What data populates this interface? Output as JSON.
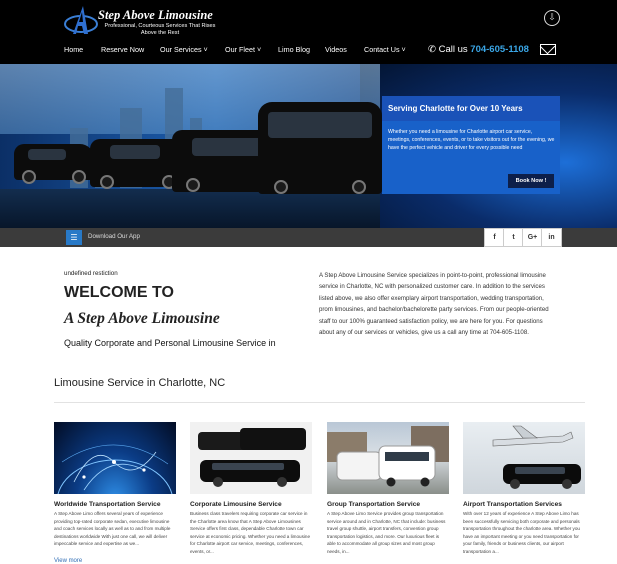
{
  "header": {
    "logo_name": "Step Above Limousine",
    "logo_tagline": "Professional, Courteous Services That Rises Above the Rest",
    "phone_label": "Call us",
    "phone_number": "704-605-1108"
  },
  "nav": {
    "items": [
      {
        "label": "Home"
      },
      {
        "label": "Reserve Now"
      },
      {
        "label": "Our Services ˅"
      },
      {
        "label": "Our Fleet ˅"
      },
      {
        "label": "Limo Blog"
      },
      {
        "label": "Videos"
      },
      {
        "label": "Contact Us ˅"
      }
    ]
  },
  "hero": {
    "promo_title": "Serving Charlotte for Over 10 Years",
    "promo_body": "Whether you need a limousine for Charlotte airport car service, meetings, conferences, events, or to take visitors out for the evening, we have the perfect vehicle and driver for every possible need",
    "promo_button": "Book Now !"
  },
  "appbar": {
    "download_label": "Download Our App",
    "social": [
      "f",
      "t",
      "G+",
      "in"
    ]
  },
  "welcome": {
    "undefined_text": "undefined restiction",
    "heading": "WELCOME TO",
    "brand": "A Step Above Limousine",
    "subheading": "Quality Corporate and Personal Limousine Service in",
    "intro": "A Step Above Limousine Service specializes in point-to-point, professional limousine service in Charlotte, NC with personalized customer care. In addition to the services listed above, we also offer exemplary airport transportation, wedding transportation, prom limousines, and bachelor/bachelorette party services. From our people-oriented staff to our 100% guaranteed satisfaction policy, we are here for you. For questions about any of our services or vehicles, give us a call any time at 704-605-1108."
  },
  "services": {
    "section_title": "Limousine Service in Charlotte, NC",
    "cards": [
      {
        "title": "Worldwide Transportation Service",
        "desc": "A Step Above Limo offers several years of experience providing top-rated corporate sedan, executive limousine and coach services locally as well as to and from multiple destinations worldwide With just one call, we will deliver impeccable service and expertise as we..."
      },
      {
        "title": "Corporate Limousine Service",
        "desc": "Business class travelers requiring corporate car service in the Charlotte area know that A Step Above Limousines Service offers first class, dependable Charlotte town car service at economic pricing. Whether you need a limousine for Charlotte airport car service, meetings, conferences, events, or..."
      },
      {
        "title": "Group Transportation Service",
        "desc": "A Step Above Limo Service provides group transportation service around and in Charlotte, NC that include: business travel group shuttle, airport transfers, convention group transportation logistics, and more. Our luxurious fleet is able to accommodate all group sizes and most group needs, in..."
      },
      {
        "title": "Airport Transportation Services",
        "desc": "With over 12 years of experience A Step Above Limo has been successfully servicing both corporate and personals transportation throughout the charlotte area. Whether you have an important meeting or you need transportation for your family, friends or business clients, our airport transportation a..."
      }
    ],
    "view_more": "View more"
  },
  "colors": {
    "accent_blue": "#1861c9",
    "link_blue": "#3aa6e6",
    "header_bg": "#000000",
    "appbar_bg": "#3b3b3b"
  }
}
